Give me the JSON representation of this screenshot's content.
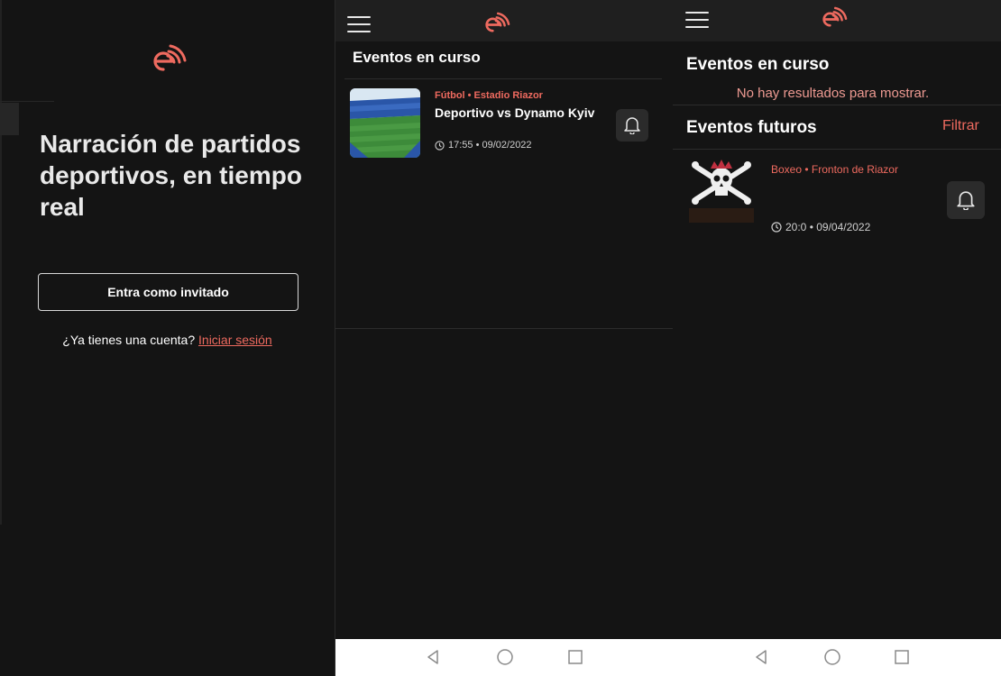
{
  "colors": {
    "accent": "#ee6a5f",
    "background": "#141414",
    "topbar": "#1f1f1f",
    "text": "#ffffff"
  },
  "login": {
    "logo_icon": "brand-logo-icon",
    "headline": "Narración de partidos deportivos, en tiempo real",
    "guest_button": "Entra como invitado",
    "account_prompt": "¿Ya tienes una cuenta?",
    "login_link": "Iniciar sesión"
  },
  "live_screen": {
    "menu_icon": "hamburger-icon",
    "section_title": "Eventos en curso",
    "events": [
      {
        "meta": "Fútbol • Estadio Riazor",
        "title": "Deportivo vs Dynamo Kyiv",
        "time": "17:55 • 09/02/2022",
        "thumb_icon": "stadium-thumbnail",
        "notify_icon": "bell-icon"
      }
    ],
    "nav_icons": [
      "back-icon",
      "home-icon",
      "recents-icon"
    ]
  },
  "events_screen": {
    "menu_icon": "hamburger-icon",
    "live_title": "Eventos en curso",
    "no_results": "No hay resultados para mostrar.",
    "future_title": "Eventos futuros",
    "filter_label": "Filtrar",
    "events": [
      {
        "meta": "Boxeo • Fronton de Riazor",
        "time": "20:0 • 09/04/2022",
        "thumb_icon": "skull-crossbones-thumbnail",
        "notify_icon": "bell-icon"
      }
    ],
    "nav_icons": [
      "back-icon",
      "home-icon",
      "recents-icon"
    ]
  }
}
